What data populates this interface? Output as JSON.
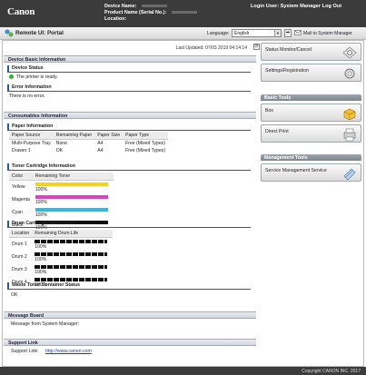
{
  "header": {
    "logo": "Canon",
    "device_name_label": "Device Name:",
    "product_name_label": "Product Name (Serial No.):",
    "location_label": "Location:",
    "login_user": "Login User: System Manager",
    "logout": "Log Out"
  },
  "titlebar": {
    "title": "Remote UI: Portal",
    "language_label": "Language:",
    "language_value": "English",
    "mail_link": "Mail to System Manager"
  },
  "main": {
    "last_updated": "Last Updated: 07/03 2019 04:14:14",
    "device_basic_info": {
      "header": "Device Basic Information",
      "device_status_title": "Device Status",
      "device_status_text": "The printer is ready.",
      "error_title": "Error Information",
      "error_text": "There is no error."
    },
    "consumables": {
      "header": "Consumables Information",
      "paper": {
        "title": "Paper Information",
        "columns": [
          "Paper Source",
          "Remaining Paper",
          "Paper Size",
          "Paper Type"
        ],
        "rows": [
          [
            "Multi-Purpose Tray",
            "None",
            "A4",
            "Free (Mixed Types)"
          ],
          [
            "Drawer 1",
            "OK",
            "A4",
            "Free (Mixed Types)"
          ]
        ]
      },
      "toner": {
        "title": "Toner Cartridge Information",
        "columns": [
          "Color",
          "Remaining Toner"
        ],
        "rows": [
          {
            "name": "Yellow",
            "percent": "100%",
            "color": "#f2d21c",
            "level": 100
          },
          {
            "name": "Magenta",
            "percent": "100%",
            "color": "#e23fc5",
            "level": 100
          },
          {
            "name": "Cyan",
            "percent": "100%",
            "color": "#36b6e8",
            "level": 100
          },
          {
            "name": "Black",
            "percent": "100%",
            "color": "#111111",
            "level": 100
          }
        ]
      },
      "drum": {
        "title": "Drum Cartridge Information",
        "columns": [
          "Location",
          "Remaining Drum Life"
        ],
        "rows": [
          {
            "name": "Drum 1",
            "percent": "100%",
            "level": 100
          },
          {
            "name": "Drum 2",
            "percent": "100%",
            "level": 100
          },
          {
            "name": "Drum 3",
            "percent": "100%",
            "level": 100
          },
          {
            "name": "Drum 4",
            "percent": "100%",
            "level": 100
          }
        ]
      },
      "waste": {
        "title": "Waste Toner Container Status",
        "text": "OK"
      }
    },
    "message_board": {
      "header": "Message Board",
      "text": "Message from System Manager:"
    },
    "support": {
      "header": "Support Link",
      "label": "Support Link:",
      "link": "http://www.canon.com"
    }
  },
  "sidebar": {
    "status_monitor": "Status Monitor/Cancel",
    "settings": "Settings/Registration",
    "basic_tools_header": "Basic Tools",
    "box": "Box",
    "direct_print": "Direct Print",
    "management_header": "Management Tools",
    "service_mgmt": "Service Management Service"
  },
  "footer": {
    "copyright": "Copyright CANON INC. 2017"
  }
}
